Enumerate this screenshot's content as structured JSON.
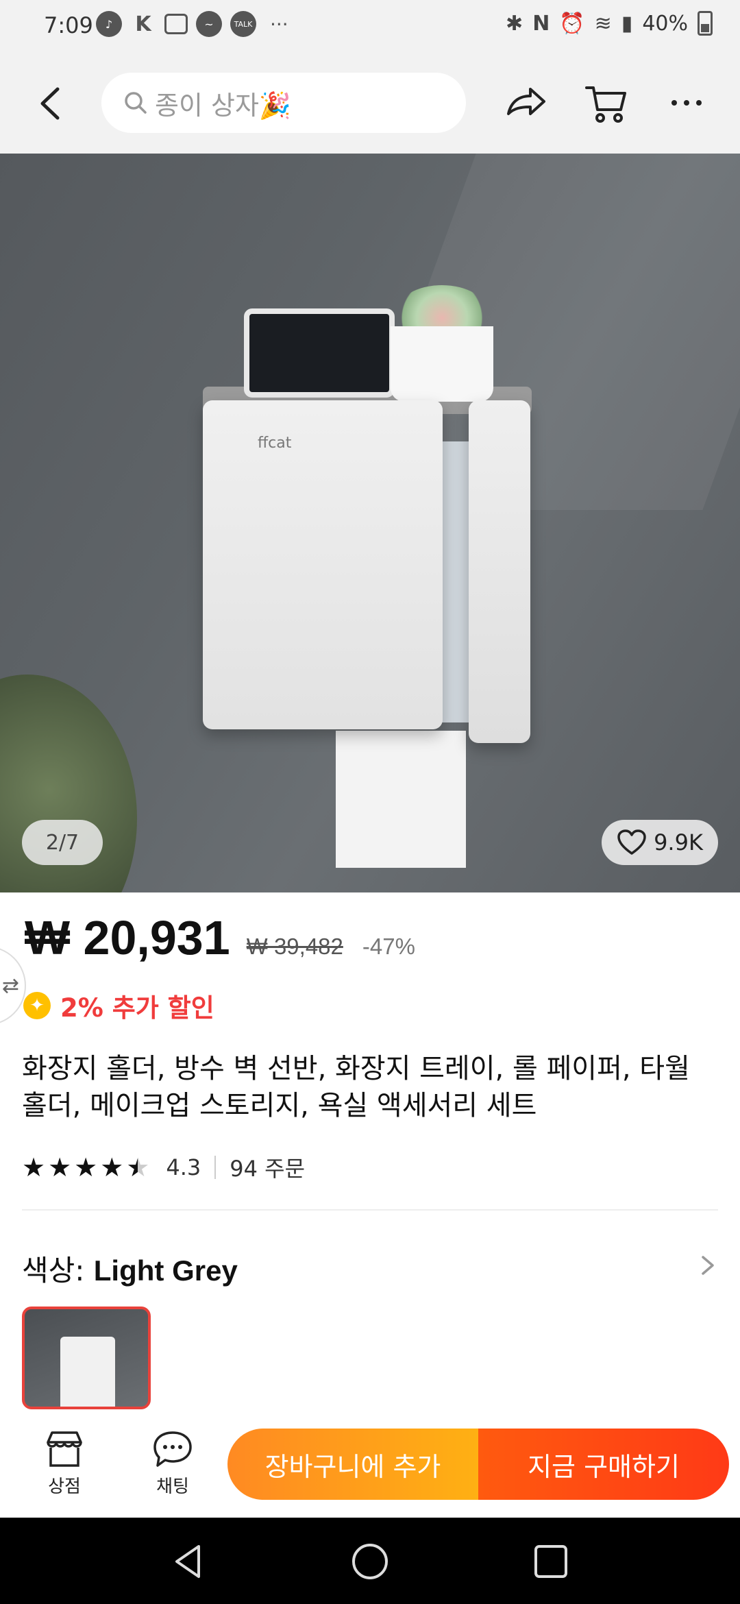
{
  "status_bar": {
    "time": "7:09",
    "battery": "40%",
    "left_icons": [
      "music-icon",
      "k-icon",
      "message-icon",
      "messenger-icon",
      "talk-icon"
    ],
    "talk_label": "TALK",
    "more": "···"
  },
  "header": {
    "search_placeholder": "종이 상자🎉",
    "icons": [
      "back-icon",
      "search-icon",
      "share-icon",
      "cart-icon",
      "more-icon"
    ]
  },
  "gallery": {
    "counter": "2/7",
    "likes": "9.9K",
    "brand": "ffcat"
  },
  "price": {
    "current": "₩ 20,931",
    "original": "₩ 39,482",
    "discount": "-47%"
  },
  "promo": {
    "text": "2% 추가 할인"
  },
  "product": {
    "title": "화장지 홀더, 방수 벽 선반, 화장지 트레이, 롤 페이퍼, 타월 홀더, 메이크업 스토리지, 욕실 액세서리 세트",
    "rating": "4.3",
    "orders": "94 주문",
    "stars": 4.3
  },
  "variant": {
    "label": "색상: ",
    "value": "Light Grey"
  },
  "action_bar": {
    "store_label": "상점",
    "chat_label": "채팅",
    "add_to_cart": "장바구니에 추가",
    "buy_now": "지금 구매하기"
  },
  "colors": {
    "accent_red": "#f03c3c",
    "cart_orange": "#ff9a1a",
    "buy_red": "#ff4a12",
    "swatch_border": "#e8423b"
  }
}
